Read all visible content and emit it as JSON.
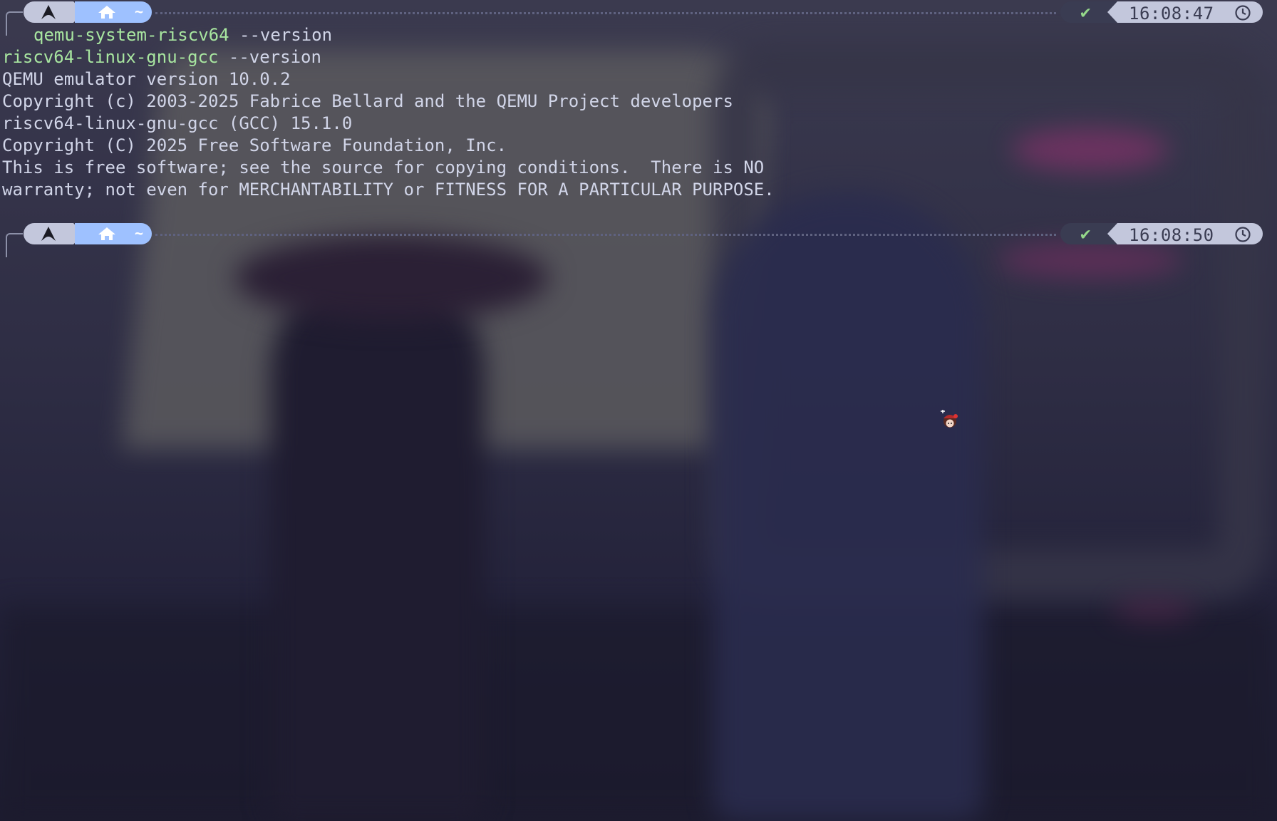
{
  "colors": {
    "background": "#22223a",
    "text": "#d1d5e8",
    "command": "#a8e6a0",
    "os_segment": "#c3c7dc",
    "dir_segment": "#9ec1ff",
    "status_ok": "#95d88a"
  },
  "prompts": [
    {
      "os_icon": "arch-linux-icon",
      "dir_icon": "home-icon",
      "dir": "~",
      "status_icon": "checkmark-icon",
      "time": "16:08:47",
      "time_icon": "clock-icon"
    },
    {
      "os_icon": "arch-linux-icon",
      "dir_icon": "home-icon",
      "dir": "~",
      "status_icon": "checkmark-icon",
      "time": "16:08:50",
      "time_icon": "clock-icon"
    }
  ],
  "session": {
    "command_line_1": {
      "cmd": "qemu-system-riscv64",
      "args": " --version"
    },
    "command_line_2": {
      "cmd": "riscv64-linux-gnu-gcc",
      "args": " --version"
    },
    "output": [
      "QEMU emulator version 10.0.2",
      "Copyright (c) 2003-2025 Fabrice Bellard and the QEMU Project developers",
      "riscv64-linux-gnu-gcc (GCC) 15.1.0",
      "Copyright (C) 2025 Free Software Foundation, Inc.",
      "This is free software; see the source for copying conditions.  There is NO",
      "warranty; not even for MERCHANTABILITY or FITNESS FOR A PARTICULAR PURPOSE."
    ]
  }
}
